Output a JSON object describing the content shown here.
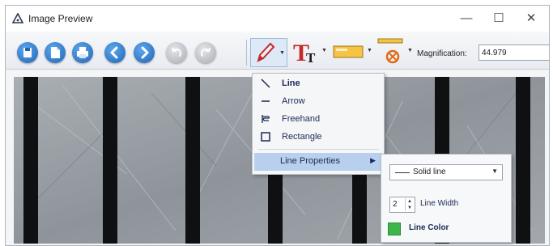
{
  "window": {
    "title": "Image Preview",
    "minimize_glyph": "—",
    "maximize_glyph": "☐",
    "close_glyph": "✕"
  },
  "toolbar": {
    "buttons": [
      {
        "name": "save-icon"
      },
      {
        "name": "open-icon"
      },
      {
        "name": "print-icon"
      },
      {
        "name": "back-icon"
      },
      {
        "name": "forward-icon"
      },
      {
        "name": "undo-icon"
      },
      {
        "name": "redo-icon"
      }
    ],
    "magnification_label": "Magnification:",
    "magnification_value": "44.979",
    "accent": "#2d7fd1"
  },
  "draw_menu": {
    "items": [
      {
        "label": "Line",
        "icon": "line-icon"
      },
      {
        "label": "Arrow",
        "icon": "arrow-icon"
      },
      {
        "label": "Freehand",
        "icon": "freehand-icon"
      },
      {
        "label": "Rectangle",
        "icon": "rectangle-icon"
      }
    ],
    "properties_label": "Line Properties"
  },
  "line_properties": {
    "style_value": "Solid line",
    "width_value": "2",
    "width_label": "Line Width",
    "color_label": "Line Color",
    "color": "#3cb54a"
  }
}
